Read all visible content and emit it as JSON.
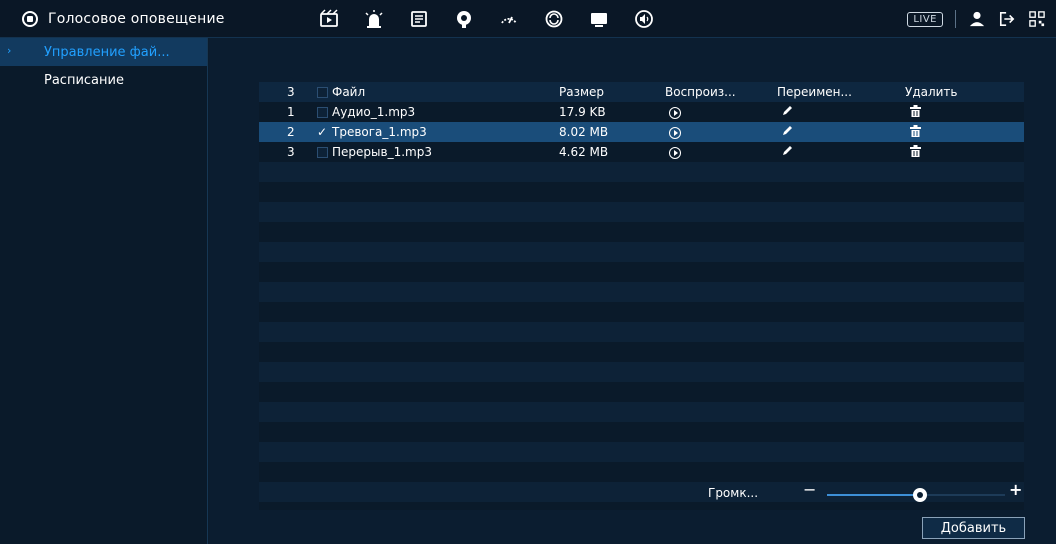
{
  "topbar": {
    "title": "Голосовое оповещение",
    "icons": [
      "video-icon",
      "alarm-icon",
      "storage-icon",
      "face-icon",
      "ptz-icon",
      "smart-icon",
      "display-icon",
      "audio-icon"
    ],
    "live_label": "LIVE"
  },
  "sidebar": {
    "items": [
      {
        "label": "Управление фай...",
        "active": true
      },
      {
        "label": "Расписание",
        "active": false
      }
    ]
  },
  "table": {
    "headers": {
      "count": "3",
      "file": "Файл",
      "size": "Размер",
      "play": "Воспроиз...",
      "rename": "Переимен...",
      "delete": "Удалить"
    },
    "rows": [
      {
        "num": "1",
        "file": "Аудио_1.mp3",
        "size": "17.9 KB",
        "checked": false
      },
      {
        "num": "2",
        "file": "Тревога_1.mp3",
        "size": "8.02 MB",
        "checked": true
      },
      {
        "num": "3",
        "file": "Перерыв_1.mp3",
        "size": "4.62 MB",
        "checked": false
      }
    ]
  },
  "volume": {
    "label": "Громк...",
    "minus": "−",
    "plus": "+",
    "level": 0.55
  },
  "add_button": "Добавить"
}
